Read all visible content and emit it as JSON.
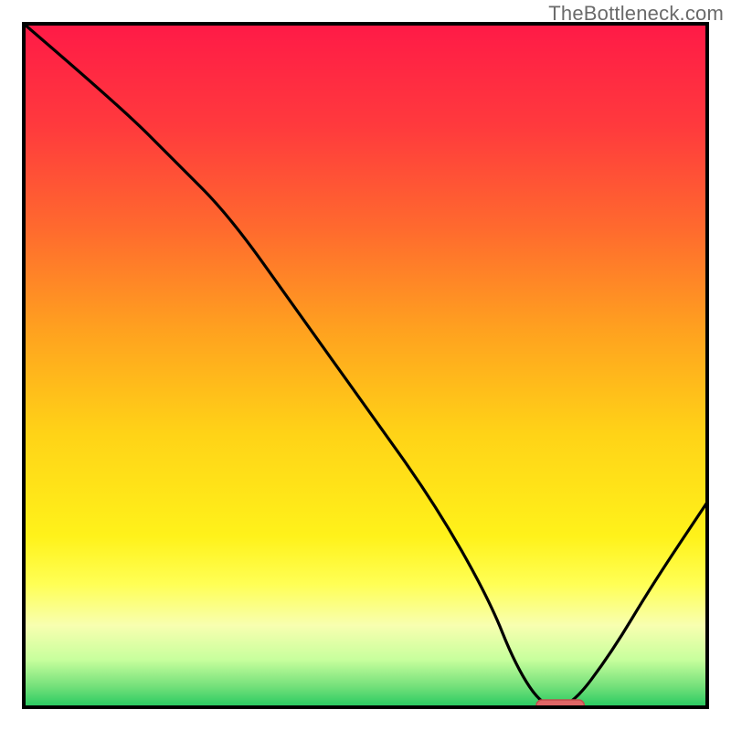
{
  "watermark": "TheBottleneck.com",
  "colors": {
    "gradient_stops": [
      {
        "offset": 0.0,
        "color": "#ff1a47"
      },
      {
        "offset": 0.15,
        "color": "#ff3a3d"
      },
      {
        "offset": 0.3,
        "color": "#ff6a2e"
      },
      {
        "offset": 0.45,
        "color": "#ffa21f"
      },
      {
        "offset": 0.6,
        "color": "#ffd317"
      },
      {
        "offset": 0.75,
        "color": "#fff21a"
      },
      {
        "offset": 0.82,
        "color": "#ffff55"
      },
      {
        "offset": 0.88,
        "color": "#f8ffb0"
      },
      {
        "offset": 0.93,
        "color": "#c8ff9d"
      },
      {
        "offset": 0.97,
        "color": "#73e07a"
      },
      {
        "offset": 1.0,
        "color": "#25c960"
      }
    ],
    "curve": "#000000",
    "marker_fill": "#e06666",
    "marker_stroke": "#c24d4d",
    "frame": "#000000"
  },
  "chart_data": {
    "type": "line",
    "title": "",
    "xlabel": "",
    "ylabel": "",
    "xlim": [
      0,
      100
    ],
    "ylim": [
      0,
      100
    ],
    "grid": false,
    "legend": false,
    "series": [
      {
        "name": "bottleneck-curve",
        "x": [
          0,
          14,
          22,
          30,
          40,
          50,
          60,
          68,
          72,
          76,
          80,
          86,
          92,
          100
        ],
        "values": [
          100,
          88,
          80,
          72,
          58,
          44,
          30,
          16,
          6,
          0,
          0,
          8,
          18,
          30
        ]
      }
    ],
    "marker": {
      "x_start": 75,
      "x_end": 82,
      "y": 0
    },
    "annotations": []
  }
}
